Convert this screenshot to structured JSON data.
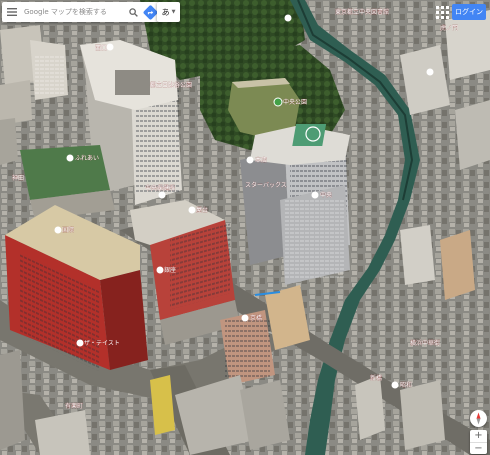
{
  "search": {
    "placeholder": "Google マップを検索する",
    "ime_mode": "あ"
  },
  "header": {
    "login_label": "ログイン"
  },
  "icons": {
    "menu": "hamburger-menu-icon",
    "search": "search-icon",
    "directions": "directions-icon",
    "apps": "apps-grid-icon",
    "compass": "compass-icon",
    "place_pin": "location-pin-icon"
  },
  "colors": {
    "accent": "#4285f4",
    "label_red": "#e53935",
    "pin_white": "#ffffff",
    "pin_green": "#43a047",
    "route_blue": "#2a8de0"
  },
  "map": {
    "view": "satellite-3d",
    "zoom_in_label": "+",
    "zoom_out_label": "−",
    "places": [
      {
        "name": "中央公園"
      },
      {
        "name": "ふれあい"
      },
      {
        "name": "中央保健所"
      },
      {
        "name": "東京都立中央図書館"
      },
      {
        "name": "都立日比谷公園"
      },
      {
        "name": "本店"
      },
      {
        "name": "スターバックス"
      },
      {
        "name": "屋台"
      },
      {
        "name": "中央"
      },
      {
        "name": "国際"
      },
      {
        "name": "ザ・テイスト"
      },
      {
        "name": "京橋"
      },
      {
        "name": "横浜中華街"
      },
      {
        "name": "銀座"
      },
      {
        "name": "西口"
      },
      {
        "name": "有楽町"
      },
      {
        "name": "昭和"
      },
      {
        "name": "神田"
      },
      {
        "name": "新橋"
      },
      {
        "name": "虎ノ門"
      }
    ]
  }
}
